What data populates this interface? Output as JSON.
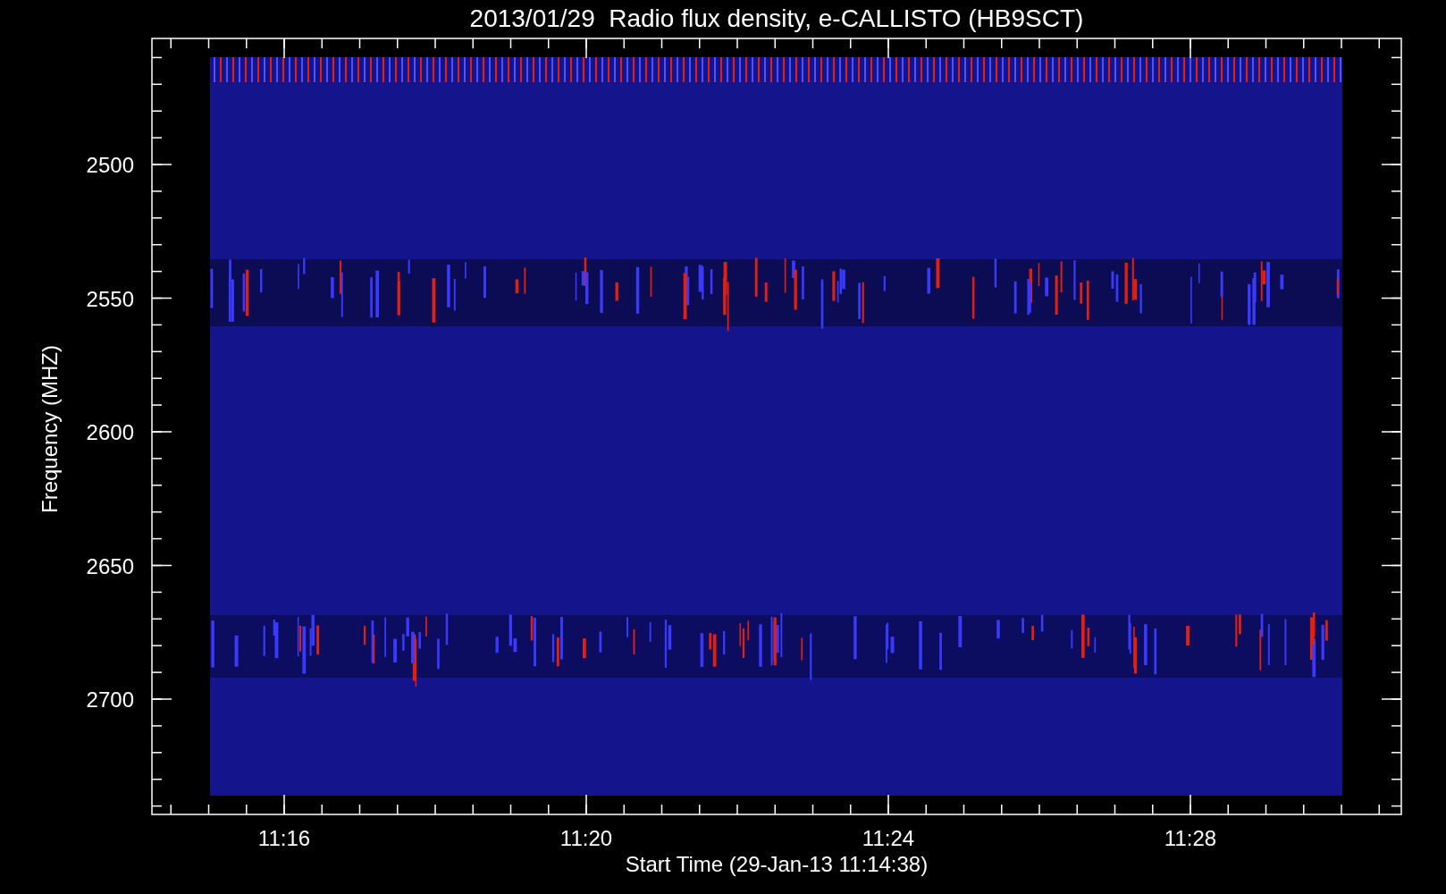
{
  "plot": {
    "title": "2013/01/29  Radio flux density, e-CALLISTO (HB9SCT)",
    "ylabel": "Frequency (MHZ)",
    "xlabel": "Start Time (29-Jan-13 11:14:38)",
    "yticks": [
      "2500",
      "2550",
      "2600",
      "2650",
      "2700"
    ],
    "xticks": [
      "11:16",
      "11:20",
      "11:24",
      "11:28"
    ]
  }
}
